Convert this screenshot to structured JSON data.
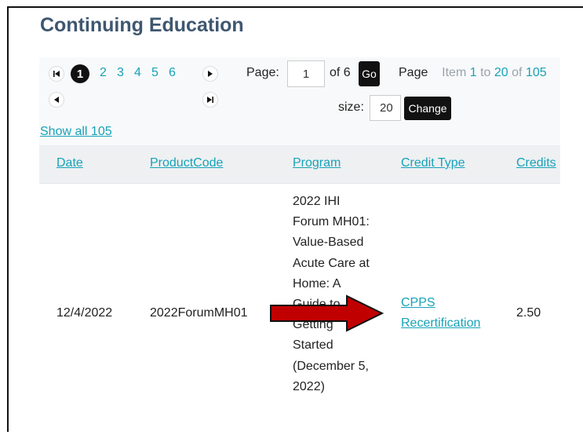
{
  "page": {
    "title": "Continuing Education"
  },
  "pager": {
    "pages": [
      "1",
      "2",
      "3",
      "4",
      "5",
      "6"
    ],
    "current": "1",
    "page_label": "Page:",
    "page_input": "1",
    "of_label": "of 6",
    "go_label": "Go",
    "page_size_label_1": "Page",
    "page_size_label_2": "size:",
    "page_size_input": "20",
    "change_label": "Change",
    "item_prefix": "Item",
    "item_start": "1",
    "item_to": "to",
    "item_end": "20",
    "item_of": "of",
    "item_total": "105"
  },
  "show_all": "Show all 105",
  "table": {
    "headers": [
      "Date",
      "ProductCode",
      "Program",
      "Credit Type",
      "Credits"
    ],
    "rows": [
      {
        "date": "12/4/2022",
        "product_code": "2022ForumMH01",
        "program_lines": [
          "2022 IHI",
          "Forum MH01:",
          "Value-Based",
          "Acute Care at",
          "Home: A",
          "Guide to",
          "Getting",
          "Started",
          "(December 5,",
          "2022)"
        ],
        "credit_type_lines": [
          "CPPS",
          "Recertification"
        ],
        "credits": "2.50"
      }
    ]
  },
  "colors": {
    "title": "#3e5770",
    "link": "#17a2b8",
    "arrow": "#c00000"
  }
}
